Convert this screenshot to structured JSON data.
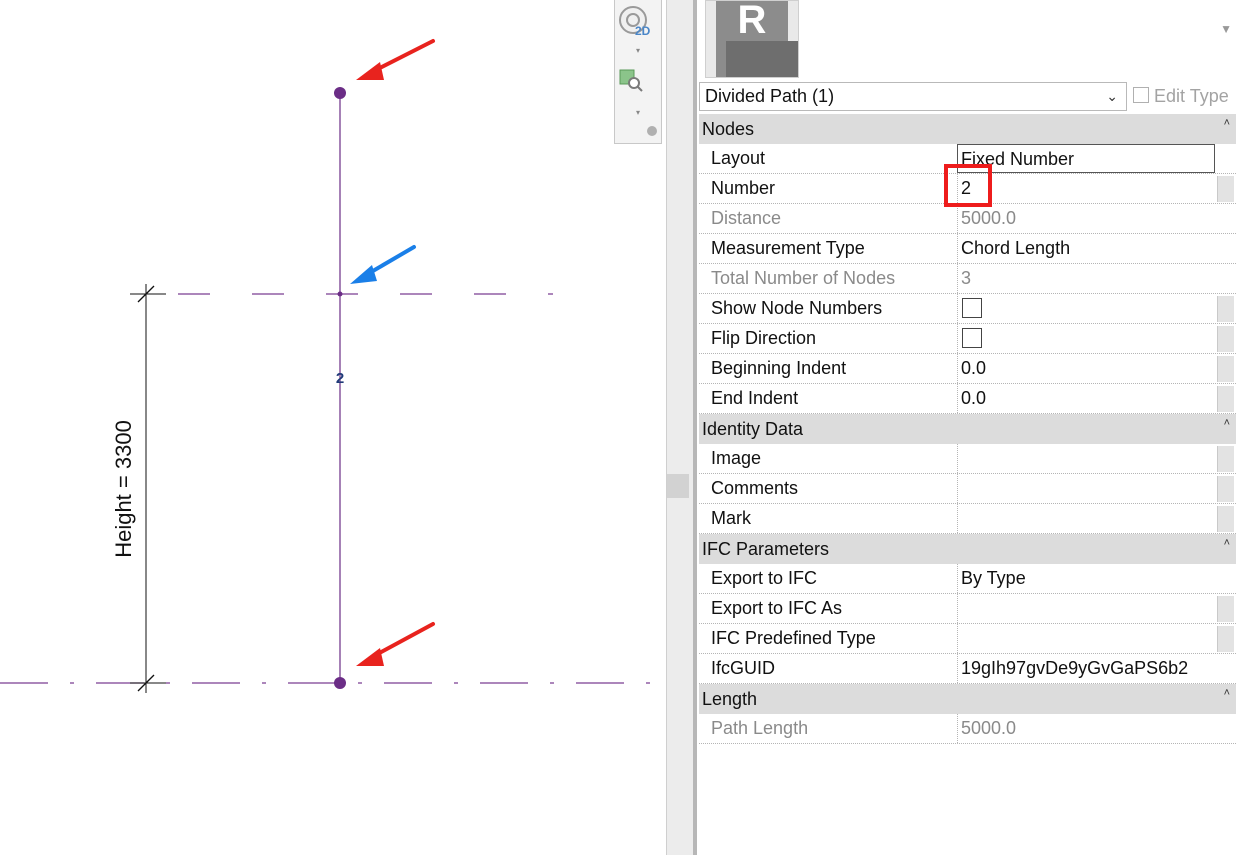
{
  "canvas": {
    "dimension_label": "Height = 3300",
    "node_number": "2",
    "colors": {
      "node": "#6b2d86",
      "line": "#6b2d86",
      "ref_line": "#7a3d92",
      "dimension": "#111111",
      "arrow_red": "#e8231e",
      "arrow_blue": "#1a7fe8",
      "number": "#1f3a78"
    }
  },
  "navbar": {
    "icons": [
      "steering-wheel-2d-icon",
      "zoom-region-icon"
    ]
  },
  "properties": {
    "type_image_letter": "R",
    "selector_value": "Divided Path (1)",
    "edit_type_label": "Edit Type",
    "groups": [
      {
        "title": "Nodes",
        "rows": [
          {
            "label": "Layout",
            "value": "Fixed Number",
            "readonly": false,
            "boxed": true
          },
          {
            "label": "Number",
            "value": "2",
            "readonly": false
          },
          {
            "label": "Distance",
            "value": "5000.0",
            "readonly": true
          },
          {
            "label": "Measurement Type",
            "value": "Chord Length",
            "readonly": false
          },
          {
            "label": "Total Number of Nodes",
            "value": "3",
            "readonly": true
          },
          {
            "label": "Show Node Numbers",
            "checkbox": true,
            "checked": false
          },
          {
            "label": "Flip Direction",
            "checkbox": true,
            "checked": false
          },
          {
            "label": "Beginning Indent",
            "value": "0.0",
            "readonly": false
          },
          {
            "label": "End Indent",
            "value": "0.0",
            "readonly": false
          }
        ]
      },
      {
        "title": "Identity Data",
        "rows": [
          {
            "label": "Image",
            "value": "",
            "readonly": false
          },
          {
            "label": "Comments",
            "value": "",
            "readonly": false
          },
          {
            "label": "Mark",
            "value": "",
            "readonly": false
          }
        ]
      },
      {
        "title": "IFC Parameters",
        "rows": [
          {
            "label": "Export to IFC",
            "value": "By Type",
            "readonly": false
          },
          {
            "label": "Export to IFC As",
            "value": "",
            "readonly": false
          },
          {
            "label": "IFC Predefined Type",
            "value": "",
            "readonly": false
          },
          {
            "label": "IfcGUID",
            "value": "19gIh97gvDe9yGvGaPS6b2",
            "readonly": false
          }
        ]
      },
      {
        "title": "Length",
        "rows": [
          {
            "label": "Path Length",
            "value": "5000.0",
            "readonly": true
          }
        ]
      }
    ]
  }
}
